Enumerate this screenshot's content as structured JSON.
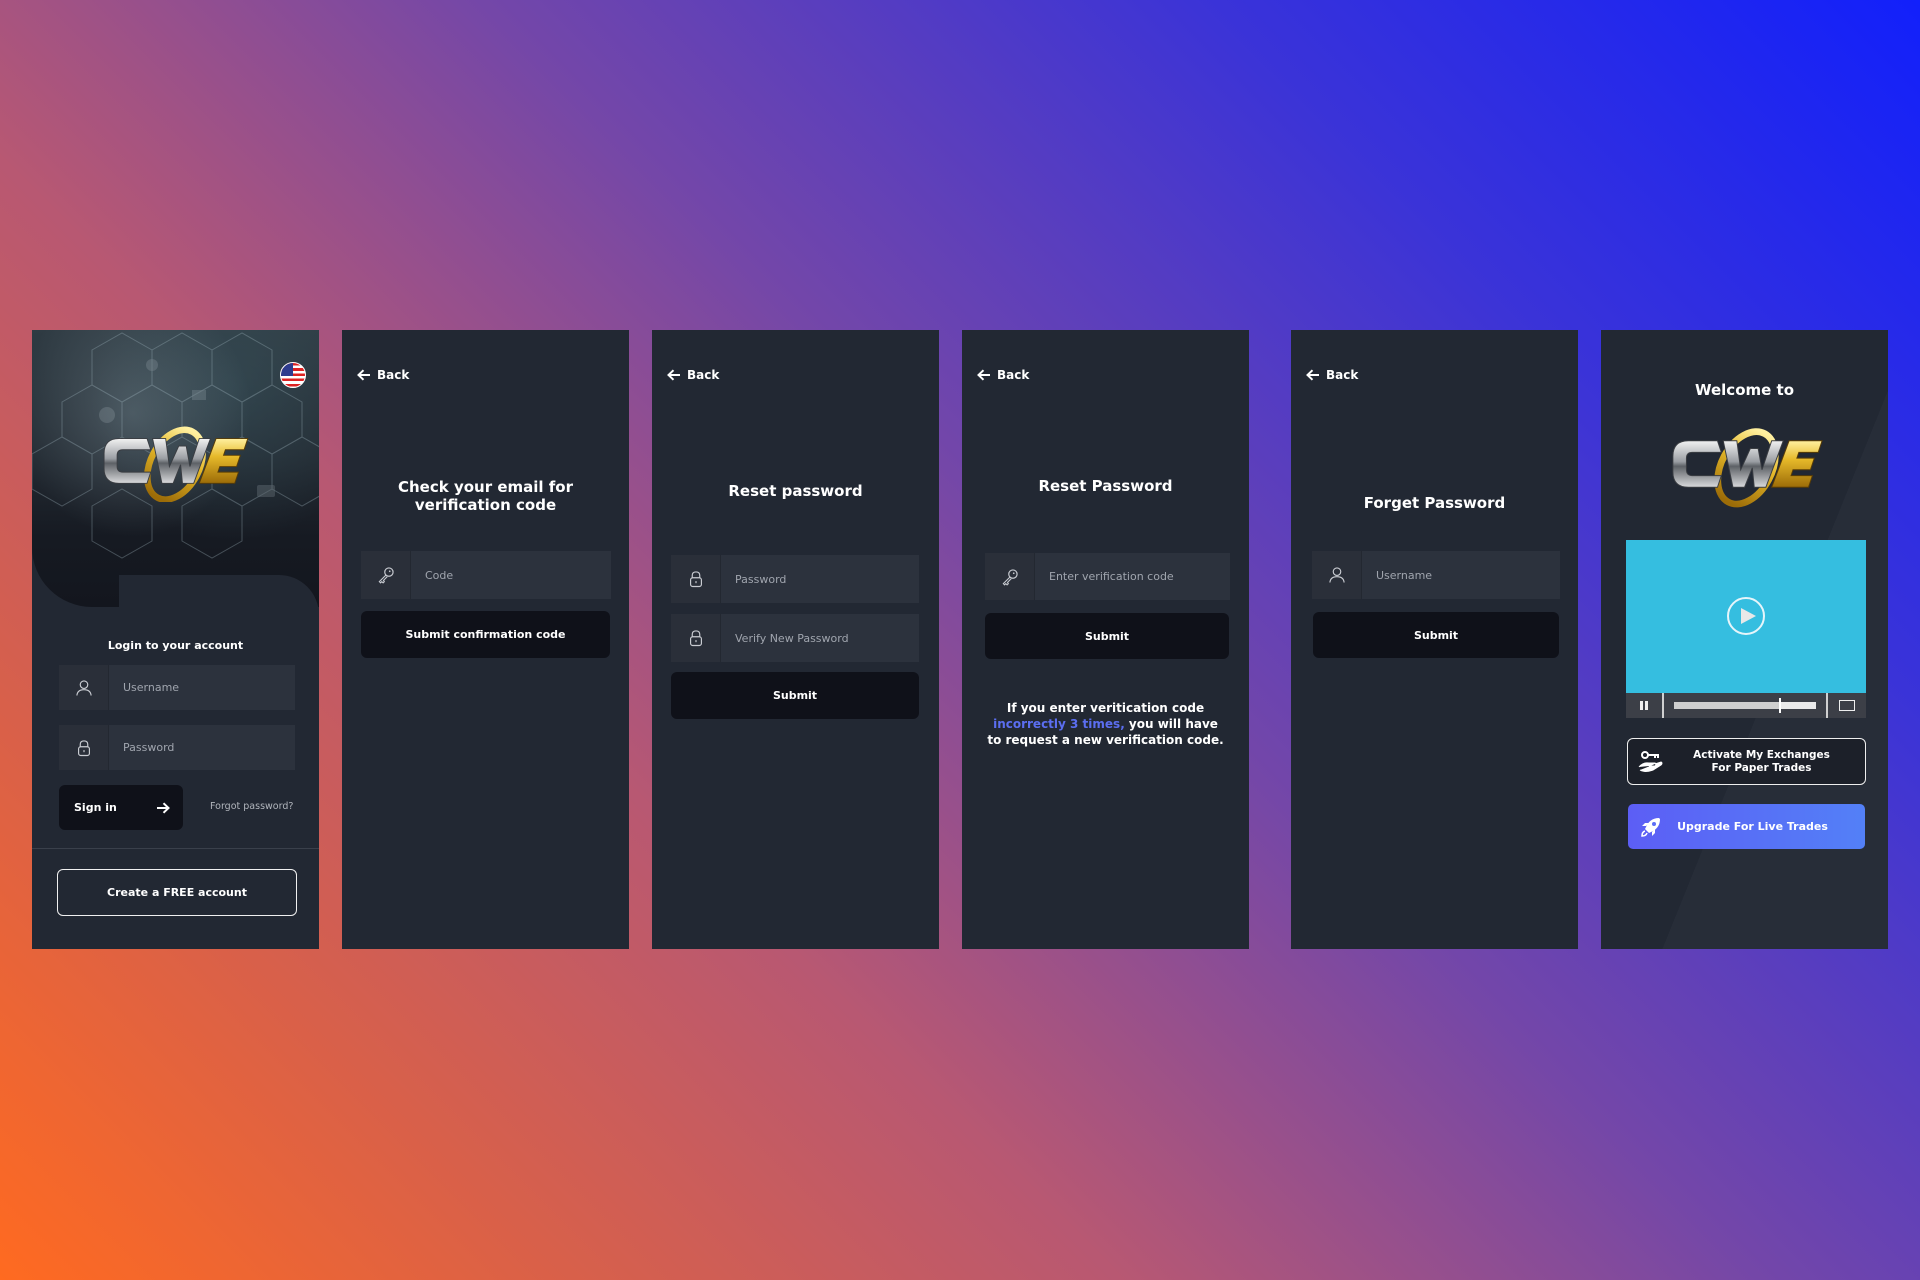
{
  "background": {
    "gradient_colors": [
      "#1220fb",
      "#7447a8",
      "#d8604a",
      "#ff6a20"
    ]
  },
  "icons": {
    "back": "arrow-left-icon",
    "user": "user-icon",
    "lock": "lock-icon",
    "key": "key-icon",
    "arrow_right": "arrow-right-icon",
    "flag": "us-flag-icon",
    "play": "play-icon",
    "pause": "pause-icon",
    "fullscreen": "fullscreen-icon",
    "hand_key": "hand-key-icon",
    "rocket": "rocket-icon"
  },
  "brand": {
    "logo_text_left": "CW",
    "logo_text_right": "E",
    "accent_gold": "#e0b020",
    "silver": "#c8c8c8"
  },
  "screens": {
    "login": {
      "language": "English (US)",
      "heading": "Login to your account",
      "username_placeholder": "Username",
      "password_placeholder": "Password",
      "signin_label": "Sign in",
      "forgot_label": "Forgot password?",
      "create_label": "Create a FREE account"
    },
    "check_email": {
      "back_label": "Back",
      "title_line1": "Check your email for",
      "title_line2": "verification code",
      "code_placeholder": "Code",
      "submit_label": "Submit confirmation code"
    },
    "reset_password": {
      "back_label": "Back",
      "title": "Reset password",
      "password_placeholder": "Password",
      "verify_placeholder": "Verify New Password",
      "submit_label": "Submit"
    },
    "reset_password_code": {
      "back_label": "Back",
      "title": "Reset Password",
      "code_placeholder": "Enter verification code",
      "submit_label": "Submit",
      "notice_line1": "If you enter veritication code",
      "notice_highlight": "incorrectly 3 times,",
      "notice_line2_rest": " you will have",
      "notice_line3": "to request a new verification code.",
      "highlight_color": "#5b6ef0"
    },
    "forget_password": {
      "back_label": "Back",
      "title": "Forget Password",
      "username_placeholder": "Username",
      "submit_label": "Submit"
    },
    "welcome": {
      "title": "Welcome to",
      "video": {
        "progress_fraction": 0.74,
        "screen_color": "#35bee0"
      },
      "activate_line1": "Activate My Exchanges",
      "activate_line2": "For Paper Trades",
      "upgrade_label": "Upgrade For Live Trades",
      "upgrade_color": "#5c6ef6"
    }
  }
}
